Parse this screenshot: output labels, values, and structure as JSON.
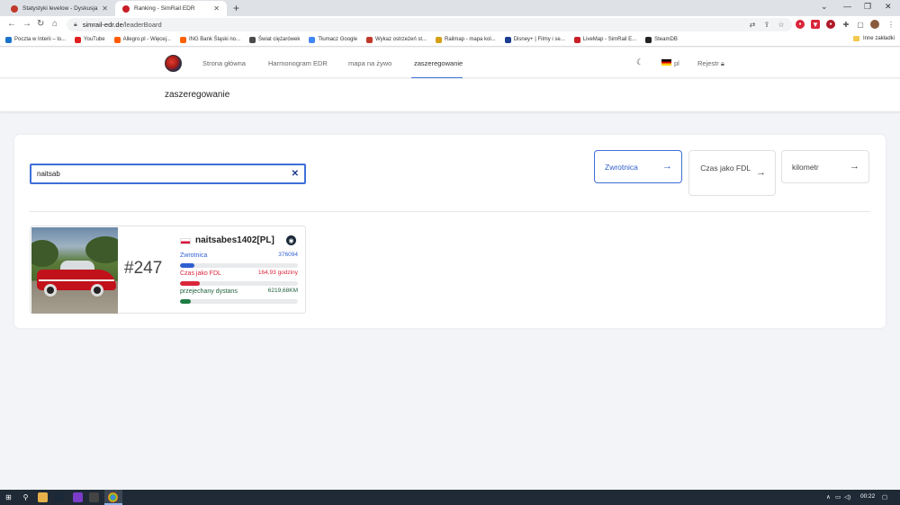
{
  "browser": {
    "tabs": [
      {
        "title": "Statystyki levelow - Dyskusja [Tr...",
        "favicon_color": "#c0392b"
      },
      {
        "title": "Ranking - SimRail EDR",
        "favicon_color": "#c81e27"
      }
    ],
    "url_host": "simrail-edr.de",
    "url_path": "/leaderBoard",
    "bookmarks": [
      {
        "label": "Poczta w Interii – lo...",
        "color": "#1a73c8"
      },
      {
        "label": "YouTube",
        "color": "#e02020"
      },
      {
        "label": "Allegro.pl - Więcej...",
        "color": "#ff5a00"
      },
      {
        "label": "ING Bank Śląski no...",
        "color": "#ff6200"
      },
      {
        "label": "Świat ciężarówek",
        "color": "#4a4a4a"
      },
      {
        "label": "Tłumacz Google",
        "color": "#4285f4"
      },
      {
        "label": "Wykaz ostrzeżeń st...",
        "color": "#c0392b"
      },
      {
        "label": "Railmap - mapa kol...",
        "color": "#d4a017"
      },
      {
        "label": "Disney+ | Filmy i se...",
        "color": "#1a3d8f"
      },
      {
        "label": "LiveMap - SimRail E...",
        "color": "#c81e27"
      },
      {
        "label": "SteamDB",
        "color": "#222222"
      }
    ],
    "other_bookmarks": "Inne zakładki"
  },
  "site": {
    "nav": {
      "home": "Strona główna",
      "schedule": "Harmonogram EDR",
      "live_map": "mapa na żywo",
      "ranking": "zaszeregowanie",
      "lang": "pl",
      "register": "Rejestr"
    },
    "page_title": "zaszeregowanie",
    "search": {
      "value": "naitsab"
    },
    "sort_buttons": {
      "switch": "Zwrotnica",
      "fdl": "Czas jako FDL",
      "km": "kilometr"
    },
    "player": {
      "rank": "#247",
      "name": "naitsabes1402[PL]",
      "stats": [
        {
          "name": "Zwrotnica",
          "value": "376094",
          "fill_fraction": 0.12,
          "color": "#2f5fd0"
        },
        {
          "name": "Czas jako FDL",
          "value": "164,93 godziny",
          "fill_fraction": 0.17,
          "color": "#d9263a"
        },
        {
          "name": "przejechany dystans",
          "value": "6219,68KM",
          "fill_fraction": 0.09,
          "color": "#1e7d45"
        }
      ]
    }
  },
  "taskbar": {
    "time": "00:22"
  }
}
